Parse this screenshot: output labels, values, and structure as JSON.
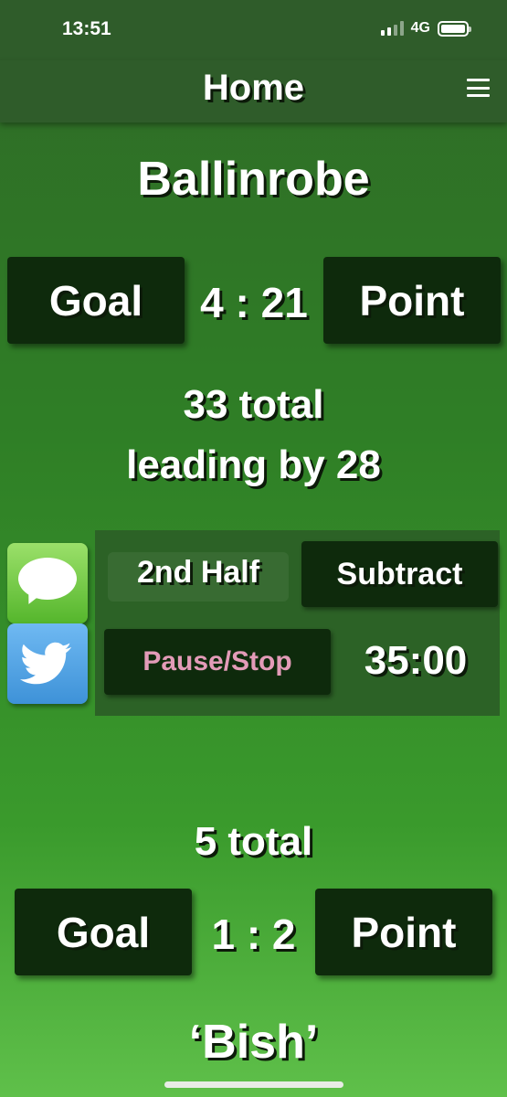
{
  "status_bar": {
    "time": "13:51",
    "network": "4G"
  },
  "nav": {
    "title": "Home"
  },
  "home_team": {
    "name": "Ballinrobe",
    "goal_label": "Goal",
    "point_label": "Point",
    "score": "4 : 21",
    "total_line": "33  total",
    "leading_line": "leading by 28"
  },
  "controls": {
    "half_label": "2nd Half",
    "subtract_label": "Subtract",
    "pause_label": "Pause/Stop",
    "clock": "35:00"
  },
  "away_team": {
    "name": "‘Bish’",
    "goal_label": "Goal",
    "point_label": "Point",
    "score": "1 : 2",
    "total_line": "5  total"
  },
  "icons": {
    "share_messages": "messages-icon",
    "share_twitter": "twitter-icon",
    "menu": "hamburger-menu-icon"
  }
}
